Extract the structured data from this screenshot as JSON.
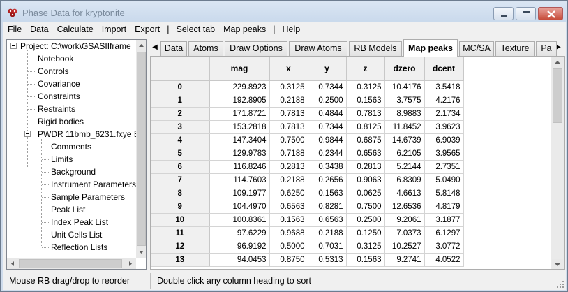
{
  "window": {
    "title": "Phase Data for kryptonite",
    "icon_label": "GSAS-II"
  },
  "menu": [
    "File",
    "Data",
    "Calculate",
    "Import",
    "Export",
    "|",
    "Select tab",
    "Map peaks",
    "|",
    "Help"
  ],
  "tree": {
    "root": "Project: C:\\work\\GSASIIframe",
    "items": [
      "Notebook",
      "Controls",
      "Covariance",
      "Constraints",
      "Restraints",
      "Rigid bodies"
    ],
    "pwdr": "PWDR 11bmb_6231.fxye B",
    "pwdr_children": [
      "Comments",
      "Limits",
      "Background",
      "Instrument Parameters",
      "Sample Parameters",
      "Peak List",
      "Index Peak List",
      "Unit Cells List",
      "Reflection Lists"
    ]
  },
  "tabs": [
    "Data",
    "Atoms",
    "Draw Options",
    "Draw Atoms",
    "RB Models",
    "Map peaks",
    "MC/SA",
    "Texture",
    "Pa"
  ],
  "active_tab": "Map peaks",
  "grid": {
    "columns": [
      "mag",
      "x",
      "y",
      "z",
      "dzero",
      "dcent"
    ],
    "rows": [
      {
        "label": "0",
        "values": [
          "229.8923",
          "0.3125",
          "0.7344",
          "0.3125",
          "10.4176",
          "3.5418"
        ]
      },
      {
        "label": "1",
        "values": [
          "192.8905",
          "0.2188",
          "0.2500",
          "0.1563",
          "3.7575",
          "4.2176"
        ]
      },
      {
        "label": "2",
        "values": [
          "171.8721",
          "0.7813",
          "0.4844",
          "0.7813",
          "8.9883",
          "2.1734"
        ]
      },
      {
        "label": "3",
        "values": [
          "153.2818",
          "0.7813",
          "0.7344",
          "0.8125",
          "11.8452",
          "3.9623"
        ]
      },
      {
        "label": "4",
        "values": [
          "147.3404",
          "0.7500",
          "0.9844",
          "0.6875",
          "14.6739",
          "6.9039"
        ]
      },
      {
        "label": "5",
        "values": [
          "129.9783",
          "0.7188",
          "0.2344",
          "0.6563",
          "6.2105",
          "3.9565"
        ]
      },
      {
        "label": "6",
        "values": [
          "116.8246",
          "0.2813",
          "0.3438",
          "0.2813",
          "5.2144",
          "2.7351"
        ]
      },
      {
        "label": "7",
        "values": [
          "114.7603",
          "0.2188",
          "0.2656",
          "0.9063",
          "6.8309",
          "5.0490"
        ]
      },
      {
        "label": "8",
        "values": [
          "109.1977",
          "0.6250",
          "0.1563",
          "0.0625",
          "4.6613",
          "5.8148"
        ]
      },
      {
        "label": "9",
        "values": [
          "104.4970",
          "0.6563",
          "0.8281",
          "0.7500",
          "12.6536",
          "4.8179"
        ]
      },
      {
        "label": "10",
        "values": [
          "100.8361",
          "0.1563",
          "0.6563",
          "0.2500",
          "9.2061",
          "3.1877"
        ]
      },
      {
        "label": "11",
        "values": [
          "97.6229",
          "0.9688",
          "0.2188",
          "0.1250",
          "7.0373",
          "6.1297"
        ]
      },
      {
        "label": "12",
        "values": [
          "96.9192",
          "0.5000",
          "0.7031",
          "0.3125",
          "10.2527",
          "3.0772"
        ]
      },
      {
        "label": "13",
        "values": [
          "94.0453",
          "0.8750",
          "0.5313",
          "0.1563",
          "9.2741",
          "4.0522"
        ]
      }
    ]
  },
  "status": {
    "left": "Mouse RB drag/drop to reorder",
    "right": "Double click any column heading to sort"
  }
}
